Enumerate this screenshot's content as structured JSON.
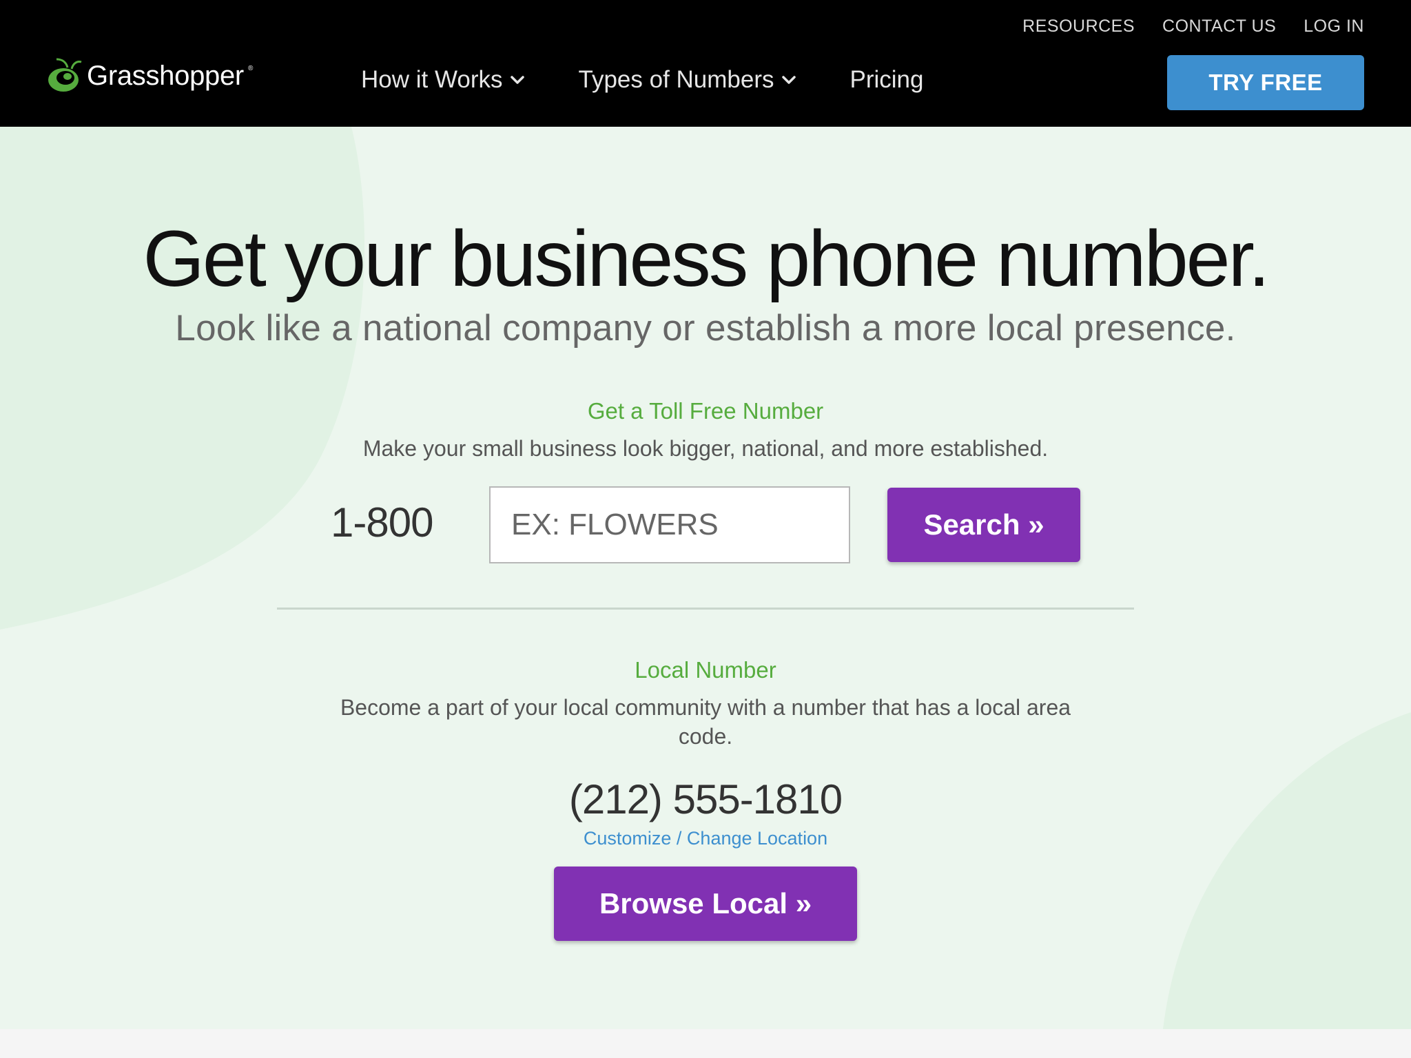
{
  "header": {
    "logo_text": "Grasshopper",
    "logo_reg": "®",
    "top_links": [
      "RESOURCES",
      "CONTACT US",
      "LOG IN"
    ],
    "nav": [
      {
        "label": "How it Works",
        "has_dropdown": true
      },
      {
        "label": "Types of Numbers",
        "has_dropdown": true
      },
      {
        "label": "Pricing",
        "has_dropdown": false
      }
    ],
    "cta_label": "TRY FREE"
  },
  "hero": {
    "headline": "Get your business phone number.",
    "subheadline": "Look like a national company or establish a more local presence.",
    "toll_free": {
      "title": "Get a Toll Free Number",
      "description": "Make your small business look bigger, national, and more established.",
      "prefix": "1-800",
      "input_placeholder": "EX: FLOWERS",
      "search_label": "Search  »"
    },
    "local": {
      "title": "Local Number",
      "description_line1": "Become a part of your local community with a number that has a local area",
      "description_line2": "code.",
      "number": "(212) 555-1810",
      "change_link": "Customize / Change Location",
      "browse_label": "Browse Local  »"
    }
  },
  "colors": {
    "header_bg": "#000000",
    "cta_blue": "#3d8fcf",
    "hero_bg": "#ecf6ee",
    "accent_green": "#56ac3e",
    "button_purple": "#8131b3",
    "link_blue": "#3d8fcf"
  },
  "icons": [
    "grasshopper-logo-icon",
    "chevron-down-icon"
  ]
}
